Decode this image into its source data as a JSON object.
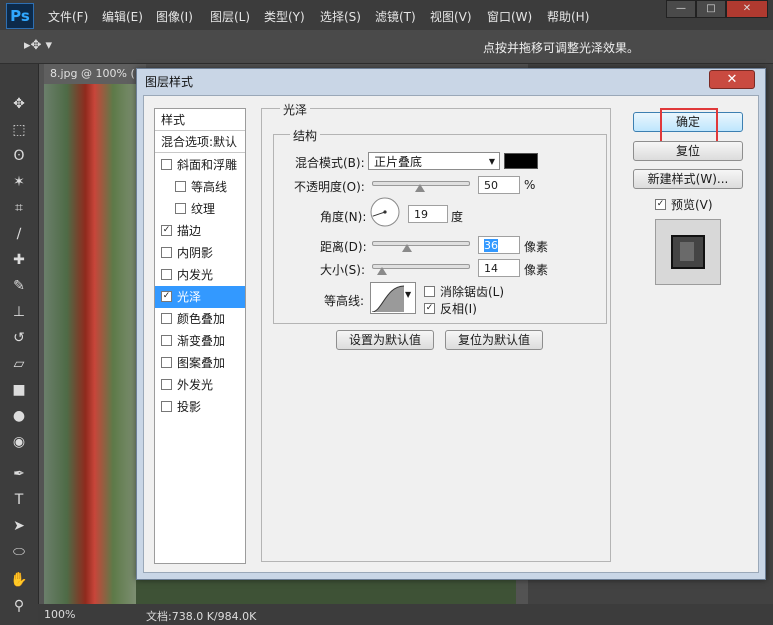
{
  "app": {
    "logo": "Ps",
    "menu": [
      "文件(F)",
      "编辑(E)",
      "图像(I)",
      "图层(L)",
      "类型(Y)",
      "选择(S)",
      "滤镜(T)",
      "视图(V)",
      "窗口(W)",
      "帮助(H)"
    ],
    "window_buttons": [
      "—",
      "□",
      "✕"
    ]
  },
  "options_bar": {
    "hint": "点按并拖移可调整光泽效果。"
  },
  "document": {
    "tab_title": "8.jpg @ 100% ("
  },
  "status": {
    "zoom": "100%",
    "doc_info": "文档:738.0 K/984.0K"
  },
  "dialog": {
    "title": "图层样式",
    "close": "✕",
    "style_list": {
      "header": "样式",
      "blend_options": "混合选项:默认",
      "items": [
        {
          "label": "斜面和浮雕",
          "checked": false,
          "indent": false
        },
        {
          "label": "等高线",
          "checked": false,
          "indent": true
        },
        {
          "label": "纹理",
          "checked": false,
          "indent": true
        },
        {
          "label": "描边",
          "checked": true,
          "indent": false
        },
        {
          "label": "内阴影",
          "checked": false,
          "indent": false
        },
        {
          "label": "内发光",
          "checked": false,
          "indent": false
        },
        {
          "label": "光泽",
          "checked": true,
          "indent": false,
          "selected": true
        },
        {
          "label": "颜色叠加",
          "checked": false,
          "indent": false
        },
        {
          "label": "渐变叠加",
          "checked": false,
          "indent": false
        },
        {
          "label": "图案叠加",
          "checked": false,
          "indent": false
        },
        {
          "label": "外发光",
          "checked": false,
          "indent": false
        },
        {
          "label": "投影",
          "checked": false,
          "indent": false
        }
      ]
    },
    "satin": {
      "group_title": "光泽",
      "structure_title": "结构",
      "blend_mode_label": "混合模式(B):",
      "blend_mode_value": "正片叠底",
      "blend_color": "#000000",
      "opacity_label": "不透明度(O):",
      "opacity_value": "50",
      "opacity_unit": "%",
      "opacity_level": 0.5,
      "angle_label": "角度(N):",
      "angle_value": "19",
      "angle_unit": "度",
      "distance_label": "距离(D):",
      "distance_value": "36",
      "distance_unit": "像素",
      "distance_level": 0.36,
      "size_label": "大小(S):",
      "size_value": "14",
      "size_unit": "像素",
      "size_level": 0.1,
      "contour_label": "等高线:",
      "anti_alias_label": "消除锯齿(L)",
      "anti_alias_checked": false,
      "invert_label": "反相(I)",
      "invert_checked": true,
      "make_default": "设置为默认值",
      "reset_default": "复位为默认值"
    },
    "buttons": {
      "ok": "确定",
      "reset": "复位",
      "new_style": "新建样式(W)...",
      "preview_label": "预览(V)",
      "preview_checked": true
    }
  }
}
